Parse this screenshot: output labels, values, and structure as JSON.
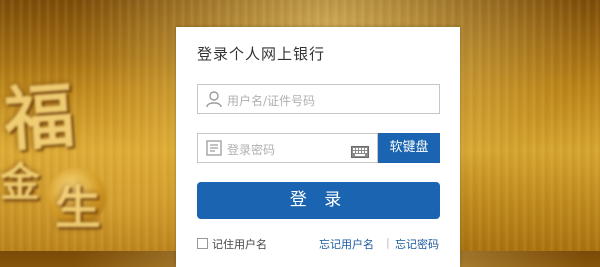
{
  "background": {
    "glyphs": [
      "福",
      "金",
      "生"
    ]
  },
  "login": {
    "title": "登录个人网上银行",
    "username_placeholder": "用户名/证件号码",
    "password_placeholder": "登录密码",
    "soft_keyboard_label": "软键盘",
    "login_button_label": "登 录",
    "remember_label": "记住用户名",
    "forgot_username_label": "忘记用户名",
    "separator": "|",
    "forgot_password_label": "忘记密码"
  },
  "icons": {
    "username": "user-icon",
    "password": "password-field-icon",
    "keyboard": "keyboard-icon"
  },
  "colors": {
    "primary_blue": "#1a64b1",
    "link_blue": "#1a5a9e",
    "placeholder": "#b0b0b0"
  }
}
